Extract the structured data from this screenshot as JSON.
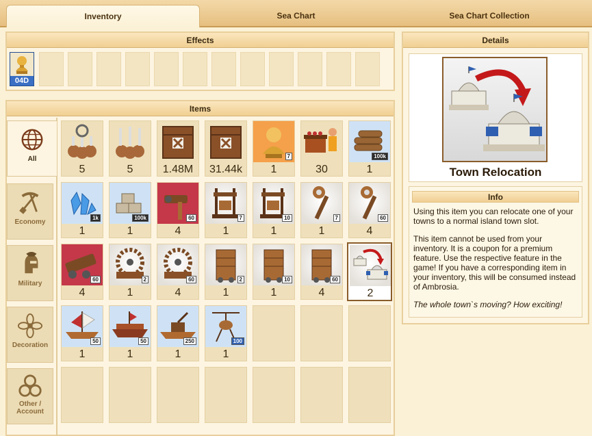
{
  "tabs": [
    "Inventory",
    "Sea Chart",
    "Sea Chart Collection"
  ],
  "effects": {
    "title": "Effects",
    "active_label": "04D"
  },
  "items": {
    "title": "Items",
    "categories": [
      "All",
      "Economy",
      "Military",
      "Decoration",
      "Other / Account"
    ],
    "grid": [
      {
        "icon": "guards-icon",
        "count": "5",
        "badge": ""
      },
      {
        "icon": "spear-crew-icon",
        "count": "5",
        "badge": ""
      },
      {
        "icon": "wooden-crate-icon",
        "count": "1.48M",
        "badge": ""
      },
      {
        "icon": "wooden-crate-icon",
        "count": "31.44k",
        "badge": ""
      },
      {
        "icon": "golden-bust-icon",
        "count": "1",
        "badge": "7"
      },
      {
        "icon": "market-stall-icon",
        "count": "30",
        "badge": ""
      },
      {
        "icon": "wood-logs-icon",
        "count": "1",
        "badge": "100k"
      },
      {
        "icon": "crystal-icon",
        "count": "1",
        "badge": "1k"
      },
      {
        "icon": "stone-blocks-icon",
        "count": "1",
        "badge": "100k"
      },
      {
        "icon": "hammer-tool-icon",
        "count": "4",
        "badge": "60"
      },
      {
        "icon": "press-icon",
        "count": "1",
        "badge": "7"
      },
      {
        "icon": "press-icon",
        "count": "1",
        "badge": "10"
      },
      {
        "icon": "scepter-icon",
        "count": "1",
        "badge": "7"
      },
      {
        "icon": "scepter-icon",
        "count": "4",
        "badge": "60"
      },
      {
        "icon": "battering-ram-icon",
        "count": "4",
        "badge": "60"
      },
      {
        "icon": "catapult-icon",
        "count": "1",
        "badge": "2"
      },
      {
        "icon": "catapult-icon",
        "count": "4",
        "badge": "60"
      },
      {
        "icon": "siege-tower-icon",
        "count": "1",
        "badge": "2"
      },
      {
        "icon": "siege-tower-icon",
        "count": "1",
        "badge": "10"
      },
      {
        "icon": "siege-tower-icon",
        "count": "4",
        "badge": "60"
      },
      {
        "icon": "town-relocation-icon",
        "count": "2",
        "badge": ""
      },
      {
        "icon": "ship-icon",
        "count": "1",
        "badge": "50"
      },
      {
        "icon": "warship-icon",
        "count": "1",
        "badge": "50"
      },
      {
        "icon": "catapult-ship-icon",
        "count": "1",
        "badge": "250"
      },
      {
        "icon": "gyrocopter-icon",
        "count": "1",
        "badge": "100"
      }
    ]
  },
  "details": {
    "title": "Details",
    "item_name": "Town Relocation",
    "info_title": "Info",
    "para1": "Using this item you can relocate one of your towns to a normal island town slot.",
    "para2": "This item cannot be used from your inventory. It is a coupon for a premium feature. Use the respective feature in the game! If you have a corresponding item in your inventory, this will be consumed instead of Ambrosia.",
    "quote": "The whole town`s moving? How exciting!"
  }
}
